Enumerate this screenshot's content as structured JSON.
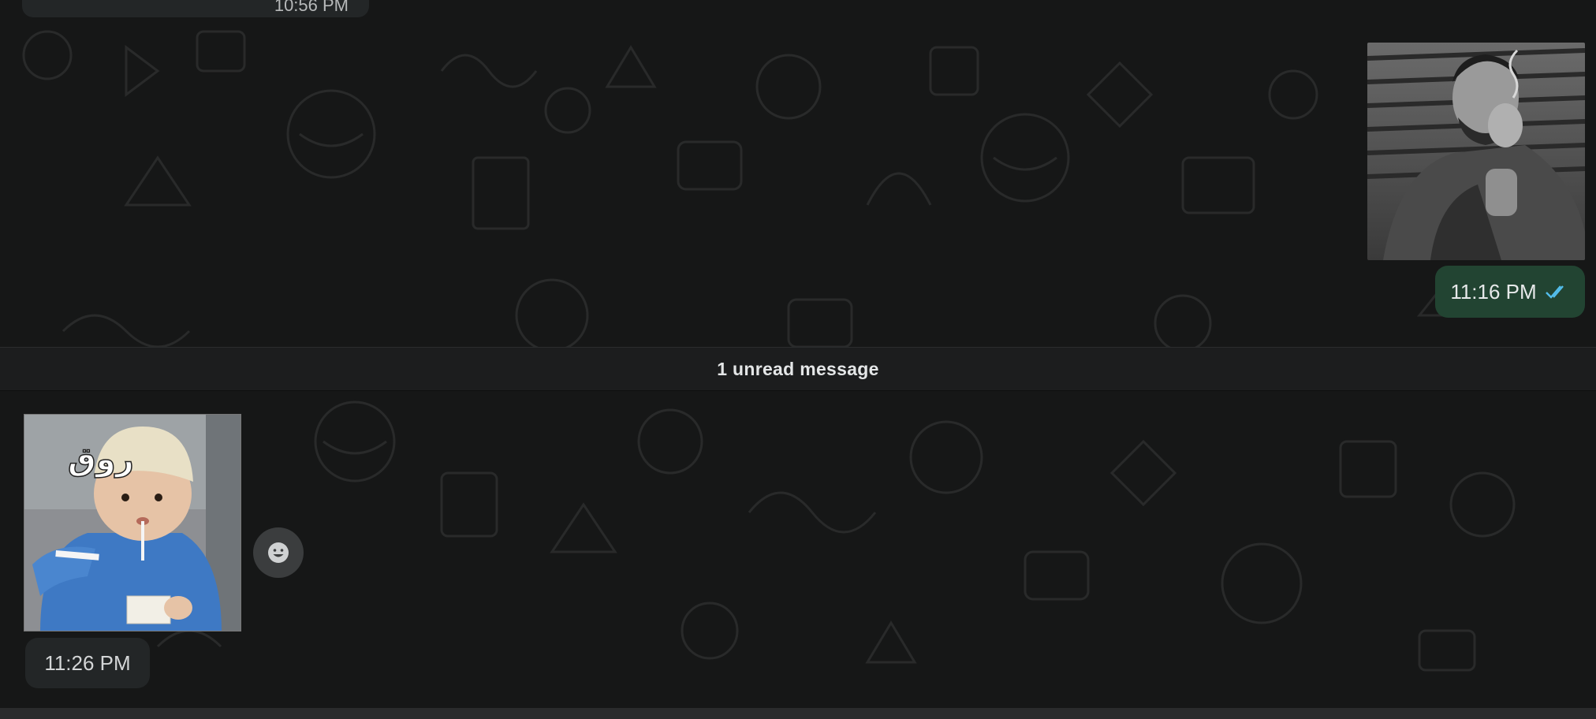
{
  "window": {
    "app": "WhatsApp",
    "view": "chat-conversation"
  },
  "messages": {
    "partial_top": {
      "time": "10:56 PM"
    },
    "outgoing_sticker": {
      "time": "11:16 PM",
      "status_icon": "double-check-icon",
      "status_color": "#53bdeb"
    },
    "unread_divider": {
      "label": "1 unread message"
    },
    "incoming_sticker": {
      "sticker_text": "روق",
      "time": "11:26 PM",
      "react_icon": "emoji-smile-icon"
    }
  },
  "colors": {
    "chat_background": "#161717",
    "outgoing_bubble": "#224432",
    "incoming_bubble": "#232627",
    "divider_background": "#1c1d1e"
  }
}
